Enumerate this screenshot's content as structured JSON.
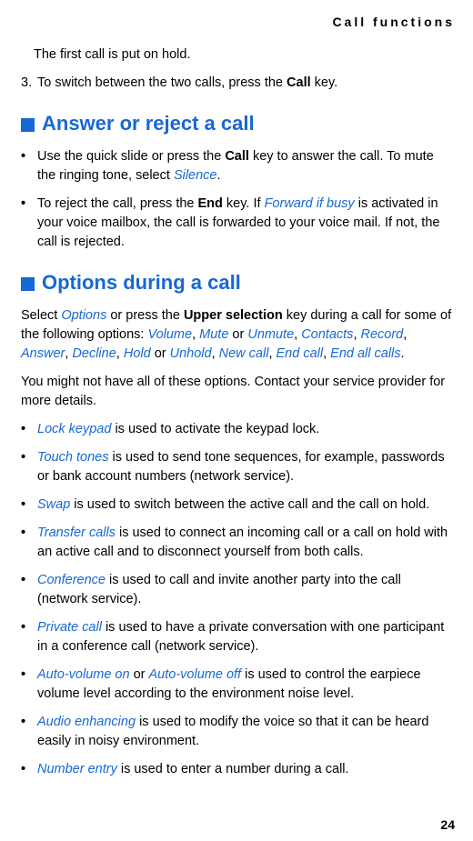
{
  "header": "Call functions",
  "intro_para": "The first call is put on hold.",
  "step3_num": "3.",
  "step3_a": "To switch between the two calls, press the ",
  "step3_b": "Call",
  "step3_c": " key.",
  "section1_title": "Answer or reject a call",
  "s1_b1_a": "Use the quick slide or press the ",
  "s1_b1_b": "Call",
  "s1_b1_c": " key to answer the call. To mute the ringing tone, select ",
  "s1_b1_d": "Silence",
  "s1_b1_e": ".",
  "s1_b2_a": "To reject the call, press the ",
  "s1_b2_b": "End",
  "s1_b2_c": " key. If ",
  "s1_b2_d": "Forward if busy",
  "s1_b2_e": " is activated in your voice mailbox, the call is forwarded to your voice mail. If not, the call is rejected.",
  "section2_title": "Options during a call",
  "s2_p1_a": "Select ",
  "s2_p1_b": "Options",
  "s2_p1_c": " or press the ",
  "s2_p1_d": "Upper selection",
  "s2_p1_e": " key during a call for some of the following options: ",
  "s2_p1_f": "Volume",
  "s2_p1_g": ", ",
  "s2_p1_h": "Mute",
  "s2_p1_i": " or ",
  "s2_p1_j": "Unmute",
  "s2_p1_k": ", ",
  "s2_p1_l": "Contacts",
  "s2_p1_m": ", ",
  "s2_p1_n": "Record",
  "s2_p1_o": ", ",
  "s2_p1_p": "Answer",
  "s2_p1_q": ", ",
  "s2_p1_r": "Decline",
  "s2_p1_s": ", ",
  "s2_p1_t": "Hold",
  "s2_p1_u": " or ",
  "s2_p1_v": "Unhold",
  "s2_p1_w": ", ",
  "s2_p1_x": "New call",
  "s2_p1_y": ", ",
  "s2_p1_z": "End call",
  "s2_p1_aa": ", ",
  "s2_p1_bb": "End all calls",
  "s2_p1_cc": ".",
  "s2_p2": "You might not have all of these options. Contact your service provider for more details.",
  "s2_b1_a": "Lock keypad",
  "s2_b1_b": " is used to activate the keypad lock.",
  "s2_b2_a": "Touch tones",
  "s2_b2_b": " is used to send tone sequences, for example, passwords or bank account numbers (network service).",
  "s2_b3_a": "Swap",
  "s2_b3_b": " is used to switch between the active call and the call on hold.",
  "s2_b4_a": "Transfer calls",
  "s2_b4_b": " is used to connect an incoming call or a call on hold with an active call and to disconnect yourself from both calls.",
  "s2_b5_a": "Conference",
  "s2_b5_b": " is used to call and invite another party into the call (network service).",
  "s2_b6_a": "Private call",
  "s2_b6_b": " is used to have a private conversation with one participant in a conference call (network service).",
  "s2_b7_a": "Auto-volume on",
  "s2_b7_b": " or ",
  "s2_b7_c": "Auto-volume off",
  "s2_b7_d": " is used to control the earpiece volume level according to the environment noise level.",
  "s2_b8_a": "Audio enhancing",
  "s2_b8_b": " is used to modify the voice so that it can be heard easily in noisy environment.",
  "s2_b9_a": "Number entry",
  "s2_b9_b": " is used to enter a number during a call.",
  "bullet": "•",
  "page_num": "24"
}
